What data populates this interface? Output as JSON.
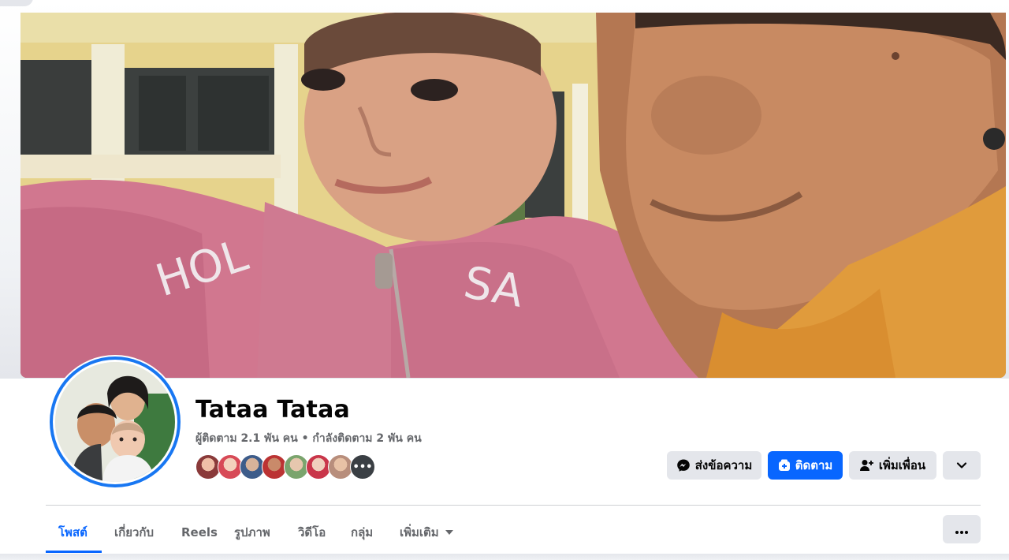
{
  "profile": {
    "name": "Tataa Tataa",
    "stats": "ผู้ติดตาม 2.1 พัน คน • กำลังติดตาม 2 พัน คน",
    "friends_more_label": "•••"
  },
  "actions": {
    "message_label": "ส่งข้อความ",
    "follow_label": "ติดตาม",
    "add_friend_label": "เพิ่มเพื่อน"
  },
  "tabs": [
    {
      "label": "โพสต์",
      "active": true
    },
    {
      "label": "เกี่ยวกับ"
    },
    {
      "label": "Reels"
    },
    {
      "label": "รูปภาพ"
    },
    {
      "label": "วิดีโอ"
    },
    {
      "label": "กลุ่ม"
    },
    {
      "label": "เพิ่มเติม"
    }
  ],
  "icons": {
    "message": "messenger-icon",
    "follow": "follow-plus-icon",
    "add_friend": "add-friend-icon",
    "chevron": "chevron-down-icon",
    "more_tab_caret": "caret-down-icon",
    "overflow": "more-dots-icon"
  },
  "colors": {
    "accent": "#0866ff",
    "avatar_ring": "#1877f2",
    "button_grey": "#e4e6eb",
    "secondary_text": "#65676b"
  }
}
